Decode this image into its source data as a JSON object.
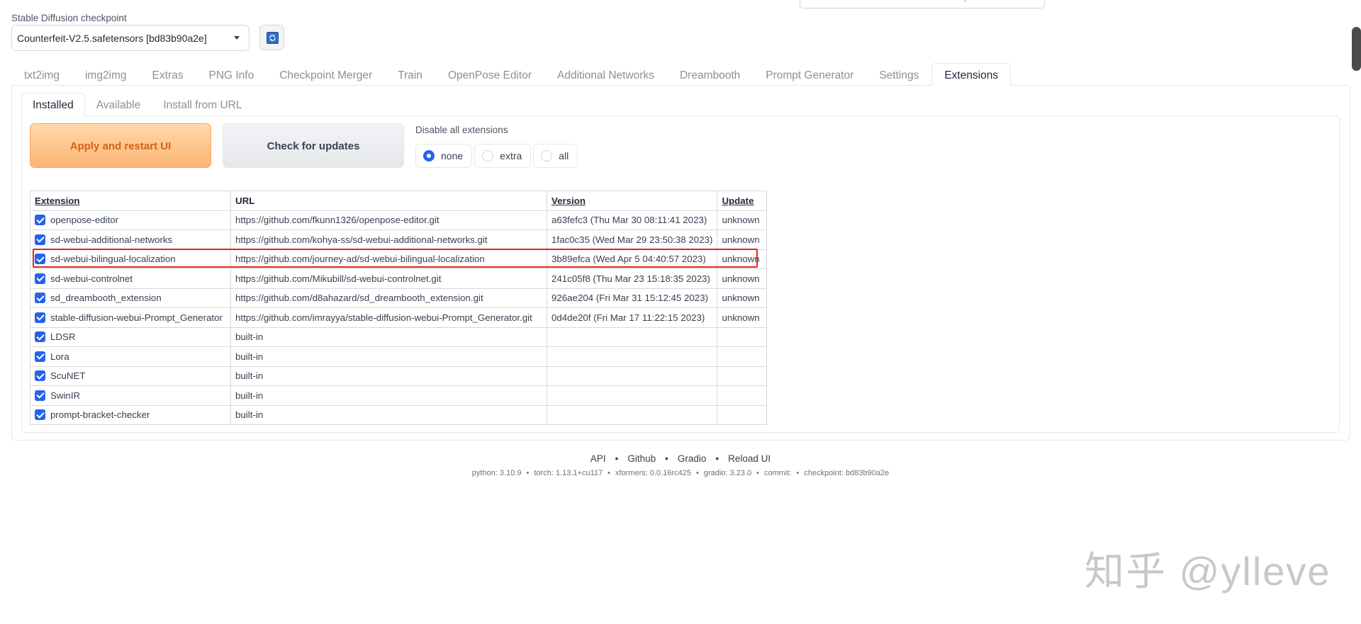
{
  "checkpoint": {
    "label": "Stable Diffusion checkpoint",
    "selected": "Counterfeit-V2.5.safetensors [bd83b90a2e]"
  },
  "main_tabs": [
    "txt2img",
    "img2img",
    "Extras",
    "PNG Info",
    "Checkpoint Merger",
    "Train",
    "OpenPose Editor",
    "Additional Networks",
    "Dreambooth",
    "Prompt Generator",
    "Settings",
    "Extensions"
  ],
  "active_main_tab": "Extensions",
  "sub_tabs": [
    "Installed",
    "Available",
    "Install from URL"
  ],
  "active_sub_tab": "Installed",
  "buttons": {
    "apply": "Apply and restart UI",
    "check": "Check for updates"
  },
  "disable": {
    "label": "Disable all extensions",
    "options": [
      "none",
      "extra",
      "all"
    ],
    "selected": "none"
  },
  "table": {
    "headers": [
      "Extension",
      "URL",
      "Version",
      "Update"
    ],
    "rows": [
      {
        "name": "openpose-editor",
        "url": "https://github.com/fkunn1326/openpose-editor.git",
        "version": "a63fefc3 (Thu Mar 30 08:11:41 2023)",
        "update": "unknown",
        "checked": true
      },
      {
        "name": "sd-webui-additional-networks",
        "url": "https://github.com/kohya-ss/sd-webui-additional-networks.git",
        "version": "1fac0c35 (Wed Mar 29 23:50:38 2023)",
        "update": "unknown",
        "checked": true
      },
      {
        "name": "sd-webui-bilingual-localization",
        "url": "https://github.com/journey-ad/sd-webui-bilingual-localization",
        "version": "3b89efca (Wed Apr 5 04:40:57 2023)",
        "update": "unknown",
        "checked": true
      },
      {
        "name": "sd-webui-controlnet",
        "url": "https://github.com/Mikubill/sd-webui-controlnet.git",
        "version": "241c05f8 (Thu Mar 23 15:18:35 2023)",
        "update": "unknown",
        "checked": true
      },
      {
        "name": "sd_dreambooth_extension",
        "url": "https://github.com/d8ahazard/sd_dreambooth_extension.git",
        "version": "926ae204 (Fri Mar 31 15:12:45 2023)",
        "update": "unknown",
        "checked": true
      },
      {
        "name": "stable-diffusion-webui-Prompt_Generator",
        "url": "https://github.com/imrayya/stable-diffusion-webui-Prompt_Generator.git",
        "version": "0d4de20f (Fri Mar 17 11:22:15 2023)",
        "update": "unknown",
        "checked": true
      },
      {
        "name": "LDSR",
        "url": "built-in",
        "version": "",
        "update": "",
        "checked": true
      },
      {
        "name": "Lora",
        "url": "built-in",
        "version": "",
        "update": "",
        "checked": true
      },
      {
        "name": "ScuNET",
        "url": "built-in",
        "version": "",
        "update": "",
        "checked": true
      },
      {
        "name": "SwinIR",
        "url": "built-in",
        "version": "",
        "update": "",
        "checked": true
      },
      {
        "name": "prompt-bracket-checker",
        "url": "built-in",
        "version": "",
        "update": "",
        "checked": true
      }
    ],
    "highlighted_row": "sd-webui-bilingual-localization"
  },
  "footer": {
    "links": [
      "API",
      "Github",
      "Gradio",
      "Reload UI"
    ],
    "separator": "•",
    "info": [
      "python: 3.10.9",
      "torch: 1.13.1+cu117",
      "xformers: 0.0.16rc425",
      "gradio: 3.23.0",
      "commit:",
      "checkpoint: bd83b90a2e"
    ]
  },
  "watermark": "知乎 @ylleve",
  "colors": {
    "accent_blue": "#2563eb",
    "apply_orange": "#fdb574",
    "highlight_red": "#e02424"
  }
}
